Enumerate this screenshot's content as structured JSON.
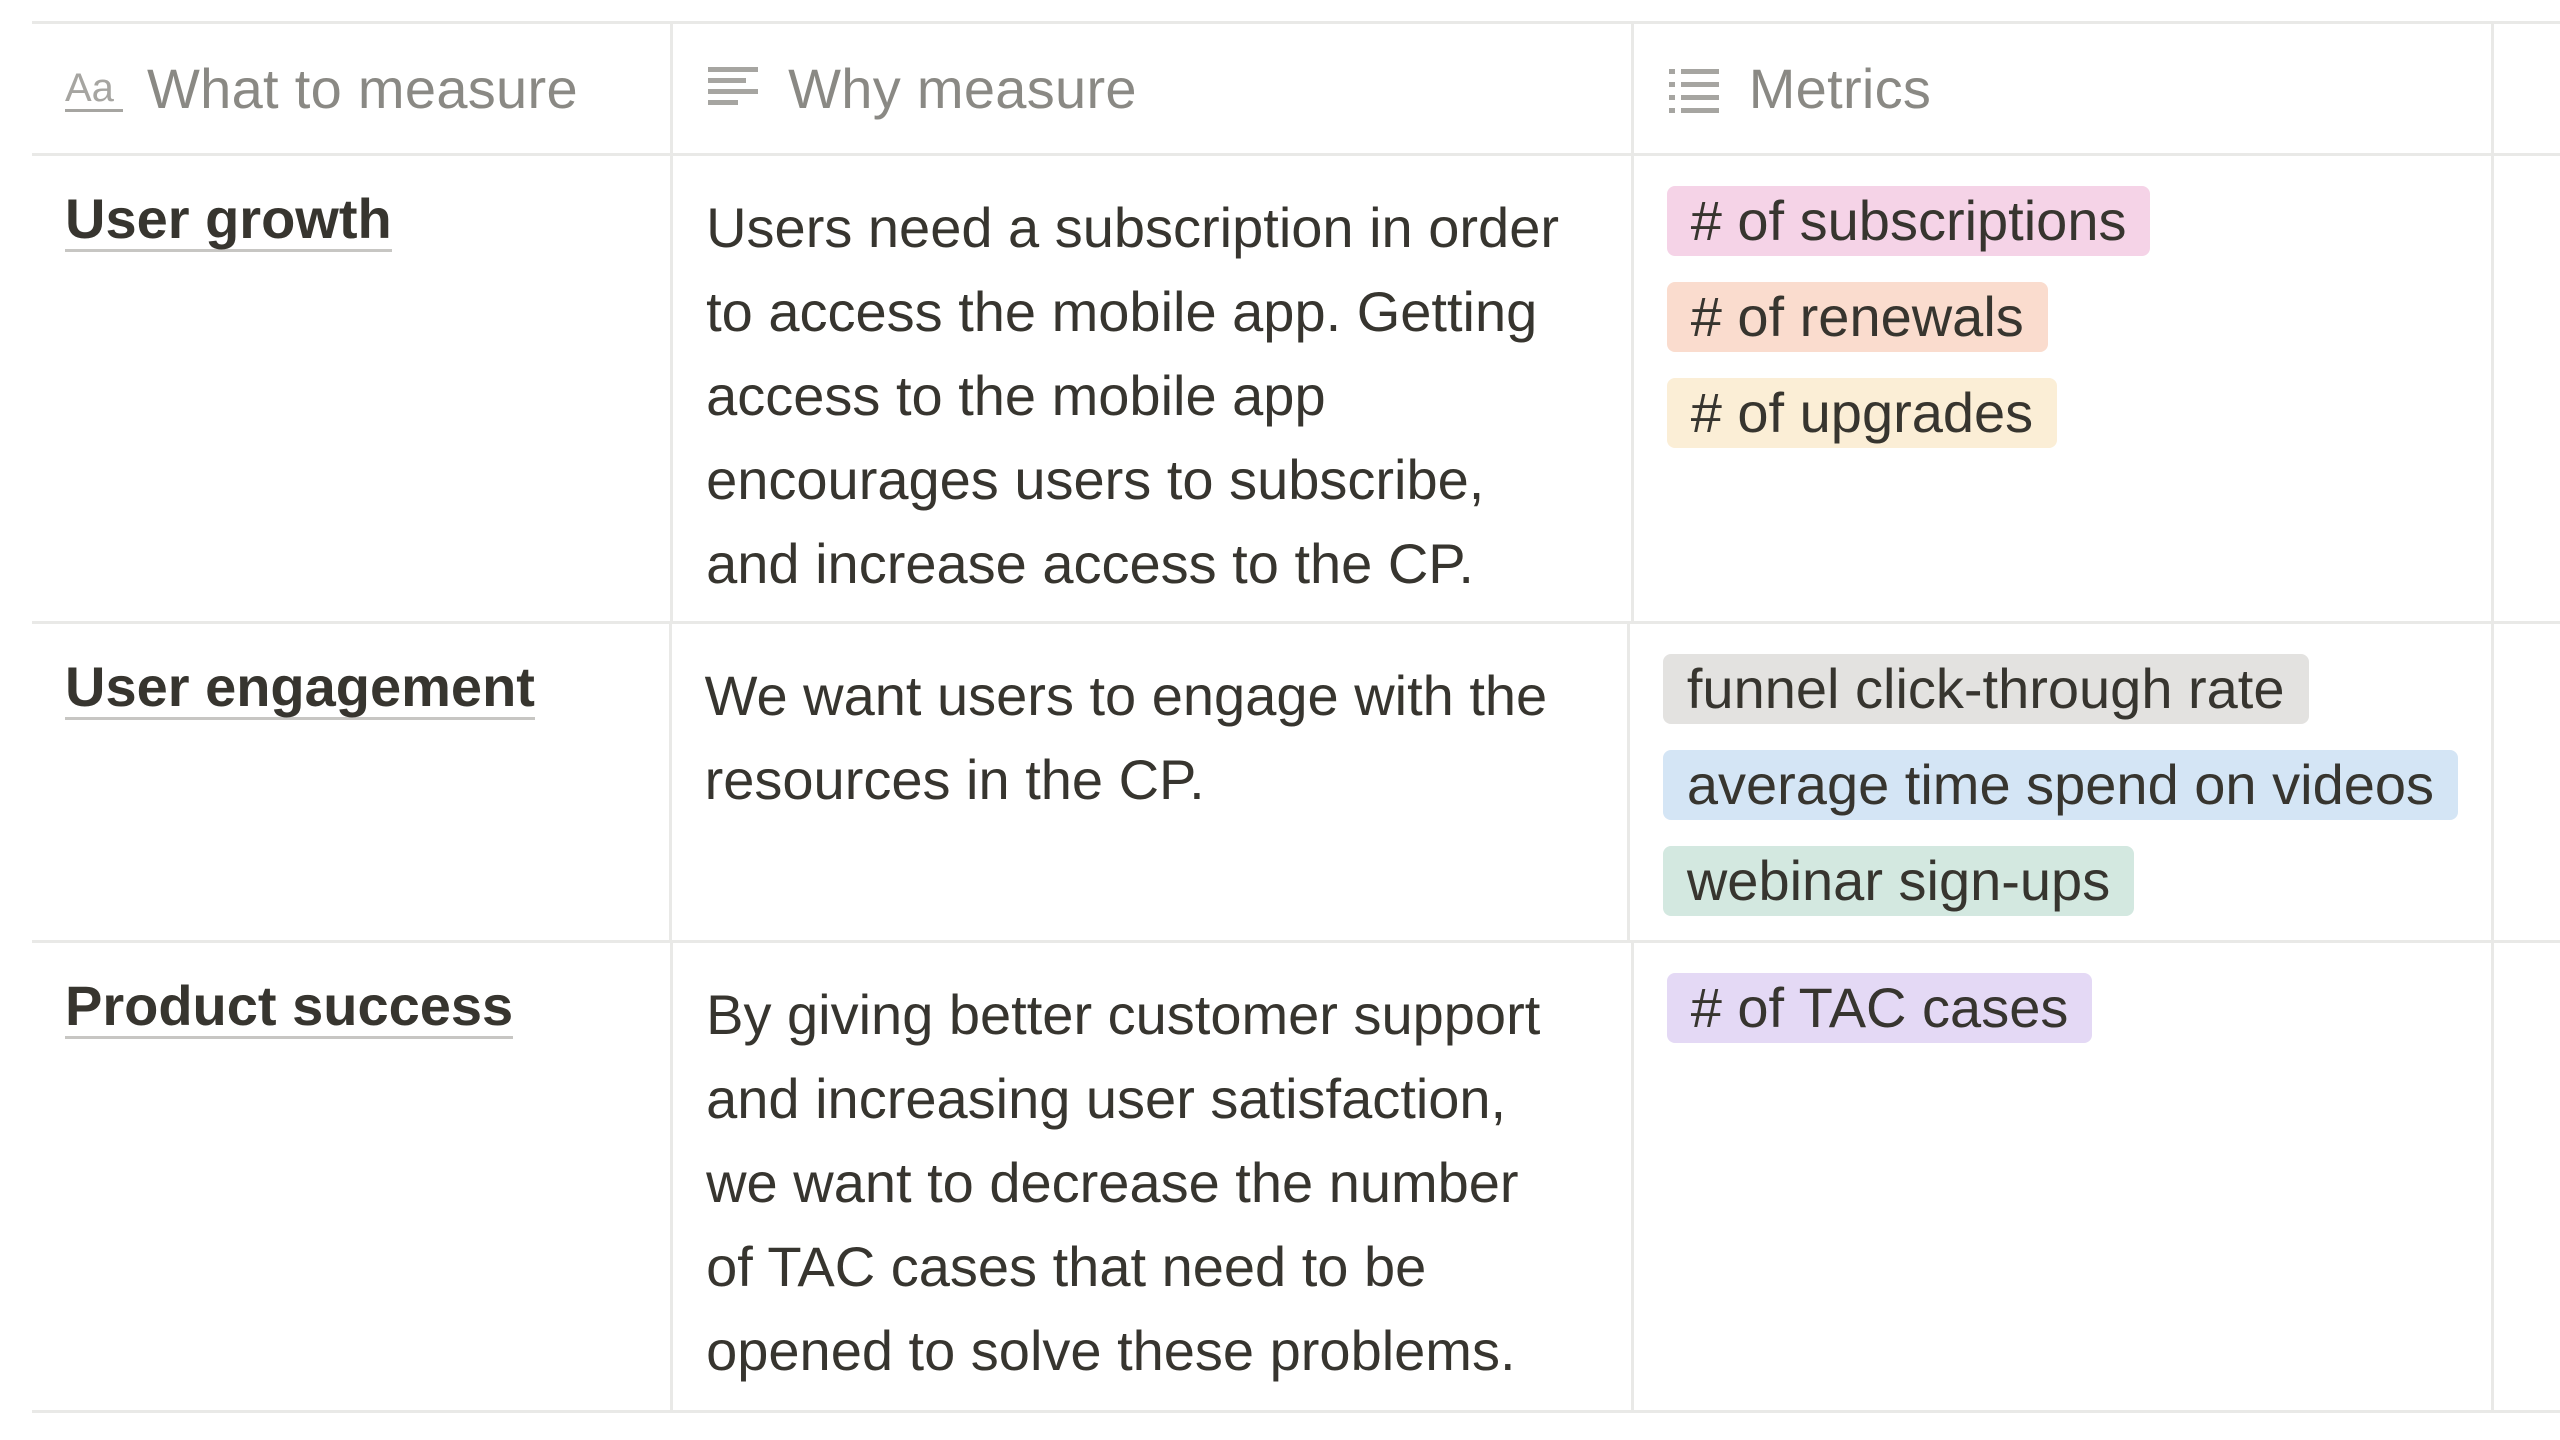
{
  "columns": [
    {
      "label": "What to measure",
      "icon": "title-property-icon"
    },
    {
      "label": "Why measure",
      "icon": "text-property-icon"
    },
    {
      "label": "Metrics",
      "icon": "multi-select-property-icon"
    }
  ],
  "rows": [
    {
      "title": "User growth",
      "why": "Users need a subscription in order\nto access the mobile app. Getting\naccess to the mobile app\nencourages users to subscribe,\nand increase access to the CP.",
      "tags": [
        {
          "label": "# of subscriptions",
          "color": "#f5d3e7"
        },
        {
          "label": "# of renewals",
          "color": "#fadcce"
        },
        {
          "label": "# of upgrades",
          "color": "#fbeed6"
        }
      ]
    },
    {
      "title": "User engagement",
      "why": "We want users to engage with the\nresources in the CP.",
      "tags": [
        {
          "label": "funnel click-through rate",
          "color": "#e3e2e0"
        },
        {
          "label": "average time spend on videos",
          "color": "#d4e5f5"
        },
        {
          "label": "webinar sign-ups",
          "color": "#d3e8e0"
        }
      ]
    },
    {
      "title": "Product success",
      "why": "By giving better customer support\nand increasing user satisfaction,\nwe want to decrease the number\nof TAC cases that need to be\nopened to solve these problems.",
      "tags": [
        {
          "label": "# of TAC cases",
          "color": "#e4d9f5"
        }
      ]
    }
  ]
}
